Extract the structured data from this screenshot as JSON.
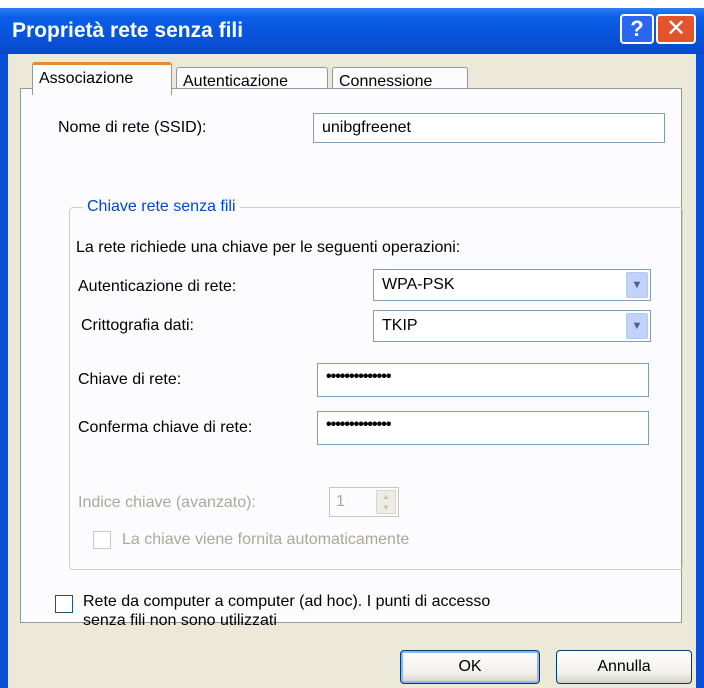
{
  "window": {
    "title": "Proprietà rete senza fili",
    "help_label": "?",
    "close_label": "✕"
  },
  "tabs": [
    {
      "label": "Associazione",
      "active": true
    },
    {
      "label": "Autenticazione",
      "active": false
    },
    {
      "label": "Connessione",
      "active": false
    }
  ],
  "ssid": {
    "label": "Nome di rete (SSID):",
    "value": "unibgfreenet"
  },
  "key_group": {
    "legend": "Chiave rete senza fili",
    "description": "La rete richiede una chiave per le seguenti operazioni:",
    "auth_label": "Autenticazione di rete:",
    "auth_value": "WPA-PSK",
    "encryption_label": "Crittografia dati:",
    "encryption_value": "TKIP",
    "key_label": "Chiave di rete:",
    "key_value": "••••••••••••••",
    "confirm_label": "Conferma chiave di rete:",
    "confirm_value": "••••••••••••••",
    "index_label": "Indice chiave (avanzato):",
    "index_value": "1",
    "auto_label": "La chiave viene fornita automaticamente"
  },
  "adhoc": {
    "line1": "Rete da computer a computer (ad hoc). I punti di accesso",
    "line2": "senza fili non sono utilizzati"
  },
  "buttons": {
    "ok": "OK",
    "cancel": "Annulla"
  },
  "colors": {
    "titlebar": "#0a54dc",
    "dialog": "#ece9d8",
    "group_legend": "#0046d5",
    "active_tab_accent": "#e68b2c"
  }
}
